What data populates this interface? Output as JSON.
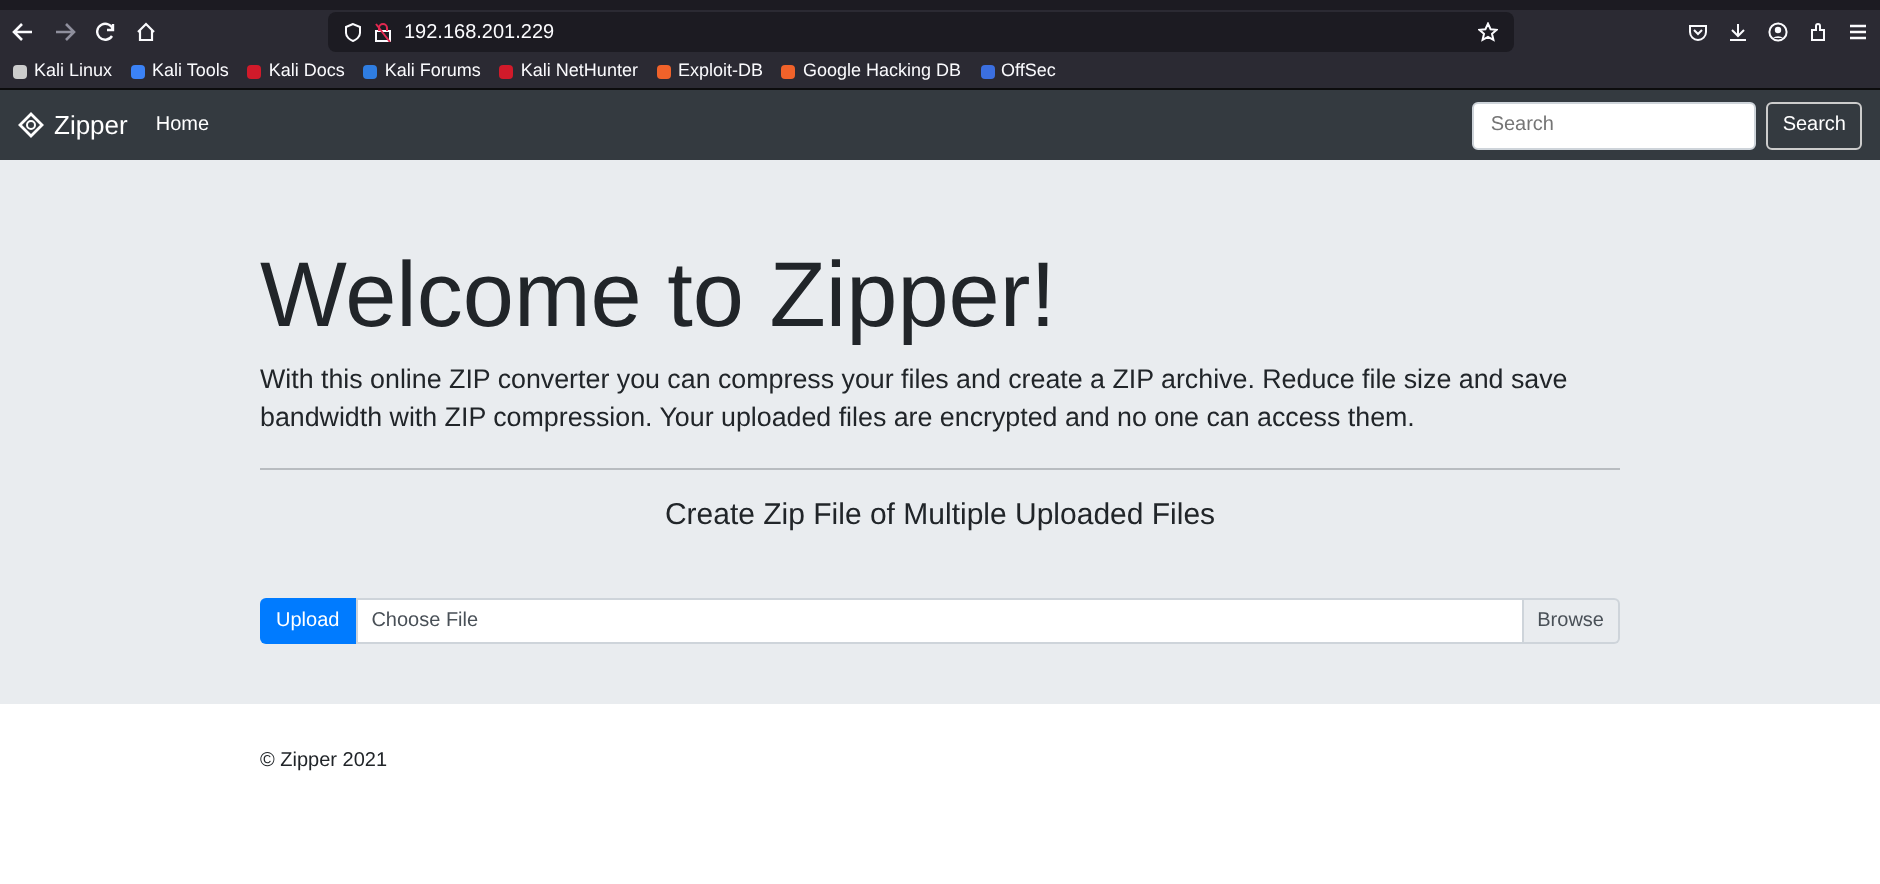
{
  "browser": {
    "address": "192.168.201.229",
    "bookmarks": [
      {
        "label": "Kali Linux",
        "color": "#cccccc"
      },
      {
        "label": "Kali Tools",
        "color": "#3b82f6"
      },
      {
        "label": "Kali Docs",
        "color": "#d11a2a"
      },
      {
        "label": "Kali Forums",
        "color": "#2f7de1"
      },
      {
        "label": "Kali NetHunter",
        "color": "#d11a2a"
      },
      {
        "label": "Exploit-DB",
        "color": "#f0622a"
      },
      {
        "label": "Google Hacking DB",
        "color": "#f0622a"
      },
      {
        "label": "OffSec",
        "color": "#3b6fe0"
      }
    ]
  },
  "navbar": {
    "brand": "Zipper",
    "links": [
      {
        "label": "Home",
        "selected": true
      }
    ],
    "search": {
      "placeholder": "Search",
      "button": "Search"
    }
  },
  "hero": {
    "title": "Welcome to Zipper!",
    "lead": "With this online ZIP converter you can compress your files and create a ZIP archive. Reduce file size and save bandwidth with ZIP compression. Your uploaded files are encrypted and no one can access them.",
    "subtitle": "Create Zip File of Multiple Uploaded Files",
    "upload": {
      "button": "Upload",
      "placeholder": "Choose File",
      "browse": "Browse"
    }
  },
  "footer": "© Zipper 2021"
}
